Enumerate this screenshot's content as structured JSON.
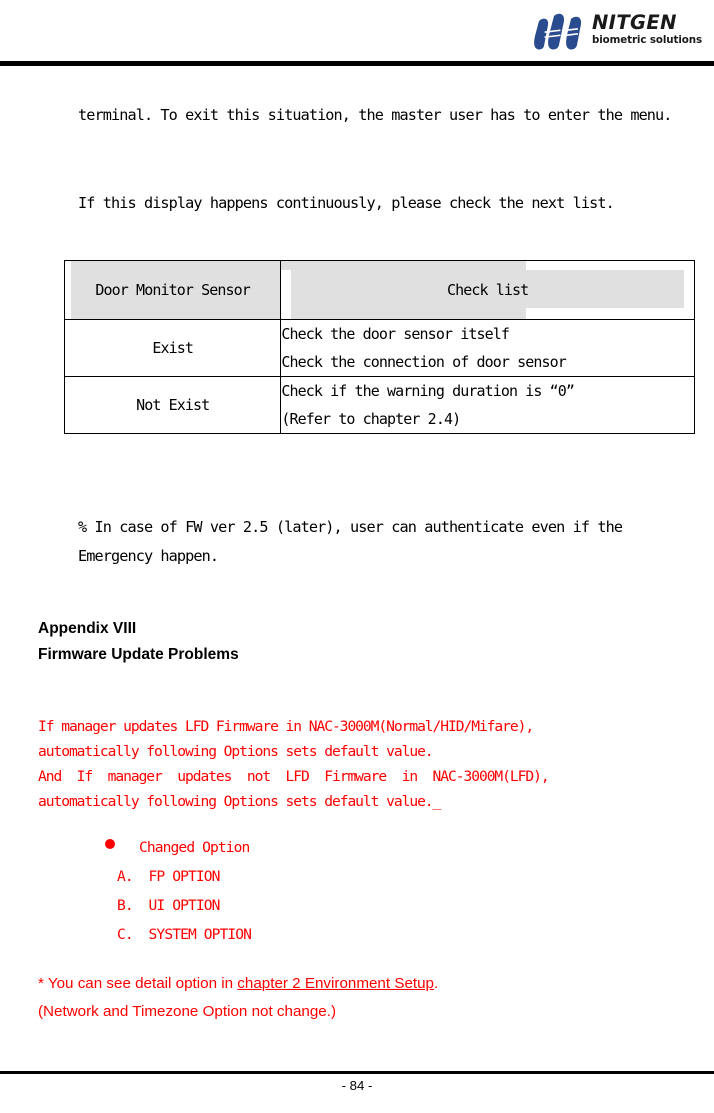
{
  "header": {
    "logo": {
      "mark_name": "nitgen-logo-mark",
      "wordmark": "NITGEN",
      "tagline": "biometric solutions",
      "color": "#2a4b8d"
    }
  },
  "body": {
    "paragraph_terminal": "terminal. To exit this situation, the master user has to enter the menu.",
    "paragraph_if_display": "If this display happens continuously, please check the next list.",
    "note_fw": "% In case of FW ver 2.5 (later), user can authenticate even if the Emergency happen."
  },
  "table": {
    "headers": {
      "col1": "Door Monitor\nSensor",
      "col2": "Check list"
    },
    "rows": [
      {
        "sensor": "Exist",
        "check": "Check the door sensor itself\nCheck the connection of door sensor"
      },
      {
        "sensor": "Not Exist",
        "check": "Check if the warning duration is  “0”\n(Refer to chapter 2.4)"
      }
    ],
    "header_fill": "#e0e0e0"
  },
  "appendix": {
    "label": "Appendix VIII",
    "title": "Firmware Update Problems",
    "intro": "If manager updates LFD Firmware in NAC-3000M(Normal/HID/Mifare),\nautomatically following Options sets default value.\nAnd  If  manager  updates  not  LFD  Firmware  in  NAC-3000M(LFD),\nautomatically following Options sets default value._",
    "changed_option_heading": "Changed Option",
    "options": [
      "A.  FP OPTION",
      "B.  UI OPTION",
      "C.  SYSTEM OPTION"
    ],
    "detail_prefix": "* You can see detail option in ",
    "detail_link": "chapter 2 Environment Setup",
    "detail_suffix": ".",
    "network_note": "(Network and Timezone Option not change.)",
    "red": "#ff0000"
  },
  "footer": {
    "page_number": "- 84 -"
  }
}
